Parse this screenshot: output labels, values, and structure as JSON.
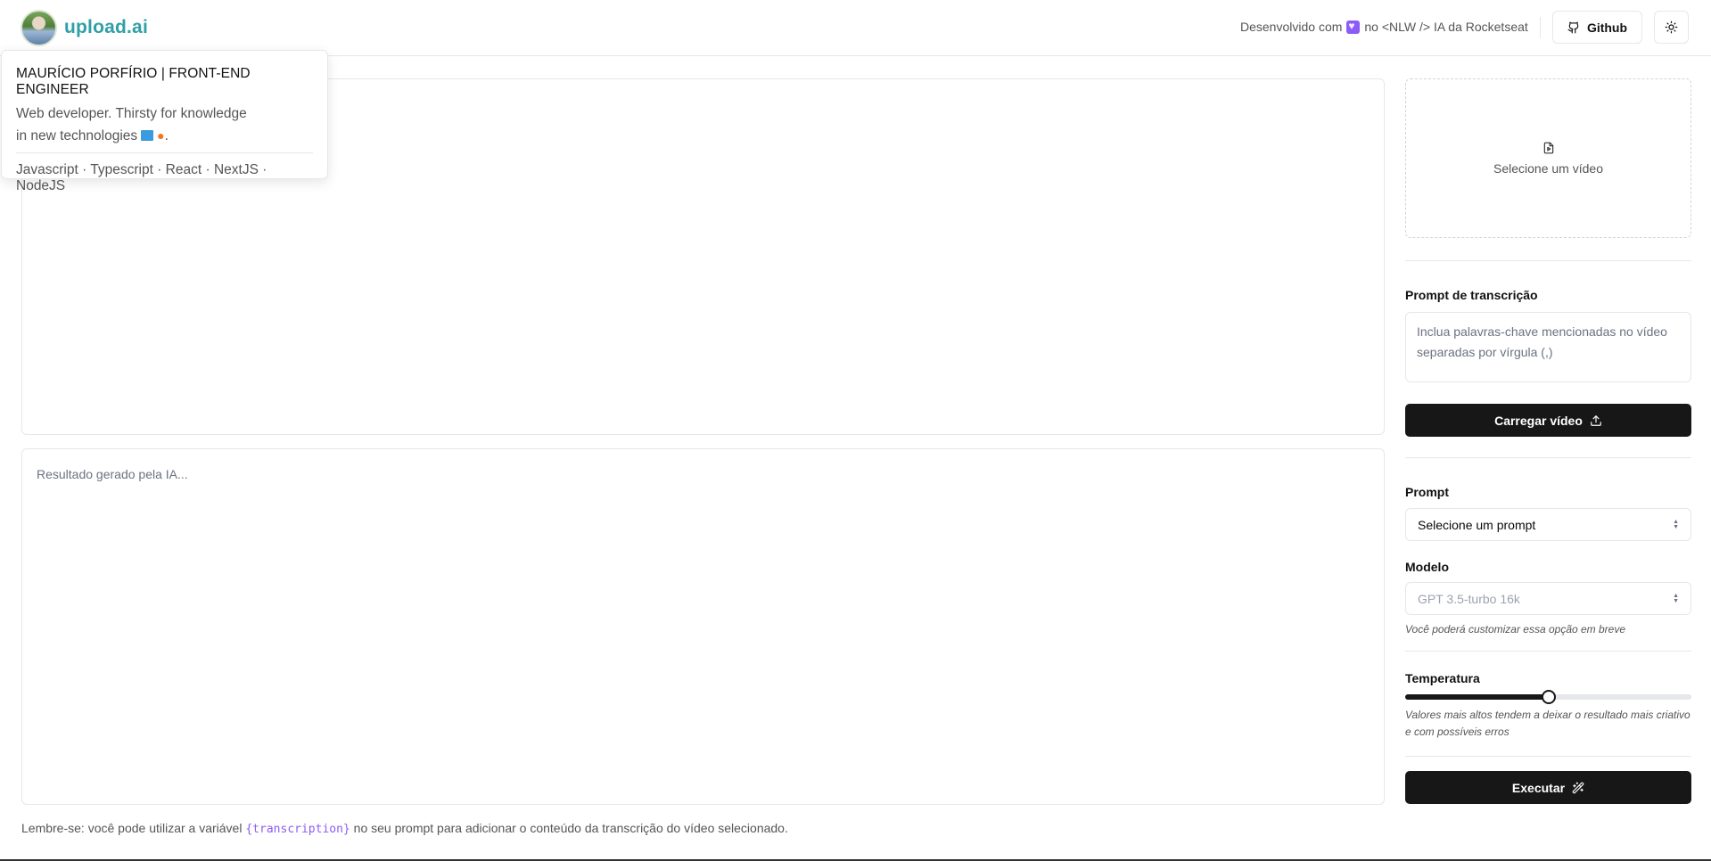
{
  "header": {
    "logo": "upload.ai",
    "credit_prefix": "Desenvolvido com",
    "credit_suffix": "no <NLW /> IA da Rocketseat",
    "github_label": "Github"
  },
  "popover": {
    "name": "MAURÍCIO PORFÍRIO | FRONT-END ENGINEER",
    "bio_line1": "Web developer. Thirsty for knowledge",
    "bio_line2": "in new technologies",
    "bio_end": ".",
    "tech": "Javascript · Typescript · React · NextJS · NodeJS"
  },
  "main": {
    "result_placeholder": "Resultado gerado pela IA...",
    "footnote_prefix": "Lembre-se: você pode utilizar a variável",
    "footnote_var": "{transcription}",
    "footnote_suffix": "no seu prompt para adicionar o conteúdo da transcrição do vídeo selecionado."
  },
  "sidebar": {
    "select_video": "Selecione um vídeo",
    "transcription_label": "Prompt de transcrição",
    "transcription_placeholder": "Inclua palavras-chave mencionadas no vídeo separadas por vírgula (,)",
    "upload_button": "Carregar vídeo",
    "prompt_label": "Prompt",
    "prompt_select": "Selecione um prompt",
    "model_label": "Modelo",
    "model_select": "GPT 3.5-turbo 16k",
    "model_hint": "Você poderá customizar essa opção em breve",
    "temperature_label": "Temperatura",
    "temperature_value": 0.5,
    "temperature_hint": "Valores mais altos tendem a deixar o resultado mais criativo e com possíveis erros",
    "execute_button": "Executar"
  },
  "colors": {
    "brand": "#2f9fa8",
    "dark_button": "#171717",
    "variable": "#8b5cf6"
  }
}
